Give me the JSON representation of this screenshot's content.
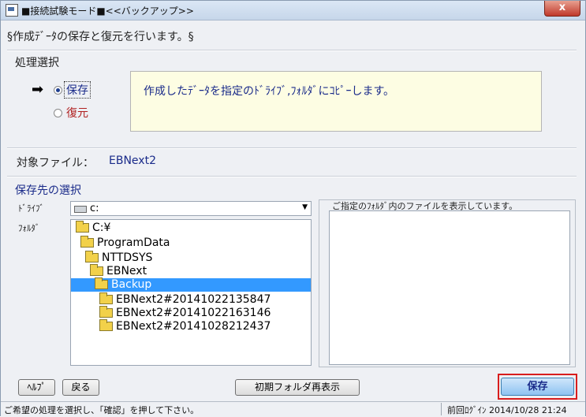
{
  "window": {
    "title": "■接続試験モード■<<バックアップ>>",
    "close_label": "x"
  },
  "header": {
    "text": "§作成ﾃﾞｰﾀの保存と復元を行います。§"
  },
  "process": {
    "label": "処理選択",
    "options": [
      {
        "label": "保存",
        "selected": true
      },
      {
        "label": "復元",
        "selected": false
      }
    ],
    "description": "作成したﾃﾞｰﾀを指定のﾄﾞﾗｲﾌﾞ,ﾌｫﾙﾀﾞにｺﾋﾟｰします。"
  },
  "target": {
    "label": "対象ファイル：",
    "value": "EBNext2"
  },
  "destination": {
    "label": "保存先の選択",
    "drive_label": "ﾄﾞﾗｲﾌﾞ",
    "folder_label": "ﾌｫﾙﾀﾞ",
    "drive_value": "c:",
    "folders": [
      {
        "name": "C:¥",
        "level": 0,
        "selected": false
      },
      {
        "name": "ProgramData",
        "level": 1,
        "selected": false
      },
      {
        "name": "NTTDSYS",
        "level": 2,
        "selected": false
      },
      {
        "name": "EBNext",
        "level": 3,
        "selected": false
      },
      {
        "name": "Backup",
        "level": 4,
        "selected": true
      },
      {
        "name": "EBNext2#20141022135847",
        "level": 5,
        "selected": false
      },
      {
        "name": "EBNext2#20141022163146",
        "level": 5,
        "selected": false
      },
      {
        "name": "EBNext2#20141028212437",
        "level": 5,
        "selected": false
      }
    ]
  },
  "files_panel": {
    "label": "ご指定のﾌｫﾙﾀﾞ内のファイルを表示しています。"
  },
  "buttons": {
    "help": "ﾍﾙﾌﾟ",
    "back": "戻る",
    "reset_folder": "初期フォルダ再表示",
    "save": "保存"
  },
  "status": {
    "message": "ご希望の処理を選択し、「確認」を押して下さい。",
    "last_login": "前回ﾛｸﾞｲﾝ 2014/10/28 21:24"
  },
  "colors": {
    "accent_text": "#1a2b8a",
    "selection": "#3399ff",
    "highlight_border": "#d81d1d",
    "description_bg": "#fdfde3"
  }
}
